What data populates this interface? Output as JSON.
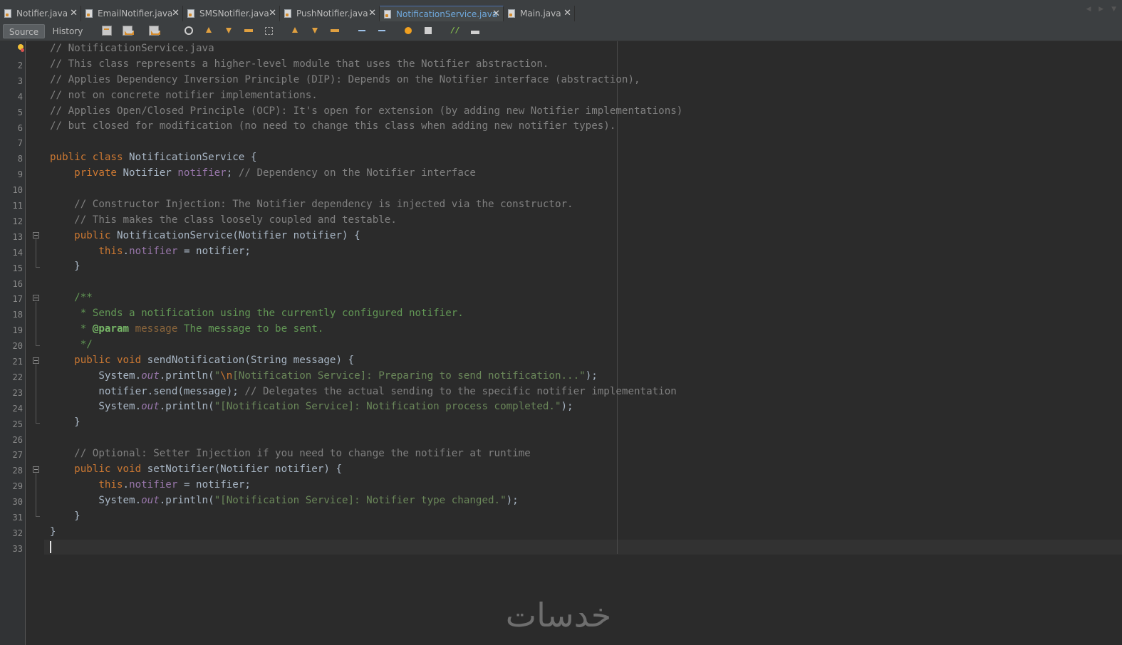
{
  "tabs": [
    {
      "label": "Notifier.java",
      "active": false
    },
    {
      "label": "EmailNotifier.java",
      "active": false
    },
    {
      "label": "SMSNotifier.java",
      "active": false
    },
    {
      "label": "PushNotifier.java",
      "active": false
    },
    {
      "label": "NotificationService.java",
      "active": true
    },
    {
      "label": "Main.java",
      "active": false
    }
  ],
  "toolbar": {
    "source_label": "Source",
    "history_label": "History"
  },
  "editor": {
    "line_numbers": [
      "2",
      "3",
      "4",
      "5",
      "6",
      "7",
      "8",
      "9",
      "10",
      "11",
      "12",
      "13",
      "14",
      "15",
      "16",
      "17",
      "18",
      "19",
      "20",
      "21",
      "22",
      "23",
      "24",
      "25",
      "26",
      "27",
      "28",
      "29",
      "30",
      "31",
      "32",
      "33"
    ],
    "lines": [
      "// NotificationService.java",
      "// This class represents a higher-level module that uses the Notifier abstraction.",
      "// Applies Dependency Inversion Principle (DIP): Depends on the Notifier interface (abstraction),",
      "// not on concrete notifier implementations.",
      "// Applies Open/Closed Principle (OCP): It's open for extension (by adding new Notifier implementations)",
      "// but closed for modification (no need to change this class when adding new notifier types).",
      "",
      "public class NotificationService {",
      "    private Notifier notifier; // Dependency on the Notifier interface",
      "",
      "    // Constructor Injection: The Notifier dependency is injected via the constructor.",
      "    // This makes the class loosely coupled and testable.",
      "    public NotificationService(Notifier notifier) {",
      "        this.notifier = notifier;",
      "    }",
      "",
      "    /**",
      "     * Sends a notification using the currently configured notifier.",
      "     * @param message The message to be sent.",
      "     */",
      "    public void sendNotification(String message) {",
      "        System.out.println(\"\\n[Notification Service]: Preparing to send notification...\");",
      "        notifier.send(message); // Delegates the actual sending to the specific notifier implementation",
      "        System.out.println(\"[Notification Service]: Notification process completed.\");",
      "    }",
      "",
      "    // Optional: Setter Injection if you need to change the notifier at runtime",
      "    public void setNotifier(Notifier notifier) {",
      "        this.notifier = notifier;",
      "        System.out.println(\"[Notification Service]: Notifier type changed.\");",
      "    }",
      "}",
      ""
    ]
  },
  "watermark": "خدسات",
  "colors": {
    "background": "#2b2b2b",
    "keyword": "#cc7832",
    "comment": "#808080",
    "string": "#6a8759",
    "field": "#9876aa",
    "text": "#a9b7c6"
  }
}
